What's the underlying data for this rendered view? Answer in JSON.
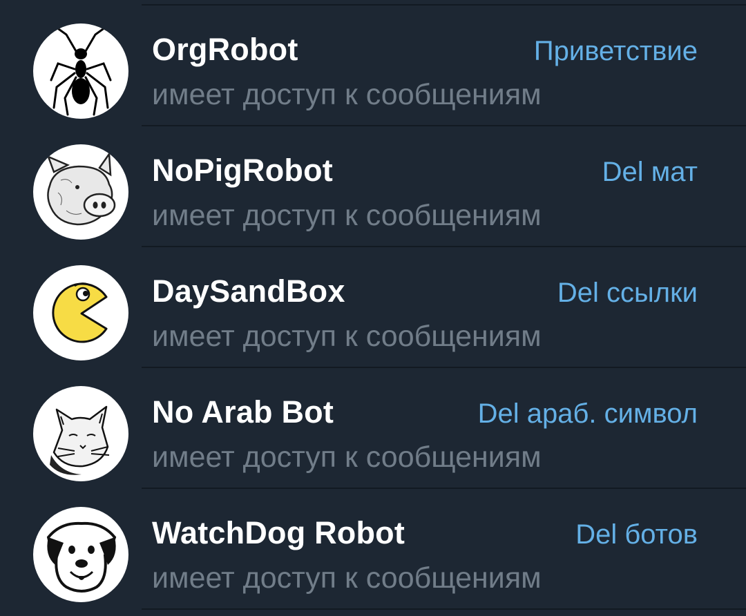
{
  "members": [
    {
      "name": "OrgRobot",
      "status": "имеет доступ к сообщениям",
      "role": "Приветствие",
      "avatar_icon": "ant-icon"
    },
    {
      "name": "NoPigRobot",
      "status": "имеет доступ к сообщениям",
      "role": "Del мат",
      "avatar_icon": "pig-icon"
    },
    {
      "name": "DaySandBox",
      "status": "имеет доступ к сообщениям",
      "role": "Del ссылки",
      "avatar_icon": "pacman-icon"
    },
    {
      "name": "No Arab Bot",
      "status": "имеет доступ к сообщениям",
      "role": "Del араб. символ",
      "avatar_icon": "cat-icon"
    },
    {
      "name": "WatchDog Robot",
      "status": "имеет доступ к сообщениям",
      "role": "Del ботов",
      "avatar_icon": "dog-icon"
    }
  ],
  "colors": {
    "background": "#1d2733",
    "name": "#ffffff",
    "status": "#717d89",
    "role": "#64b0e6",
    "divider": "#121a22"
  }
}
